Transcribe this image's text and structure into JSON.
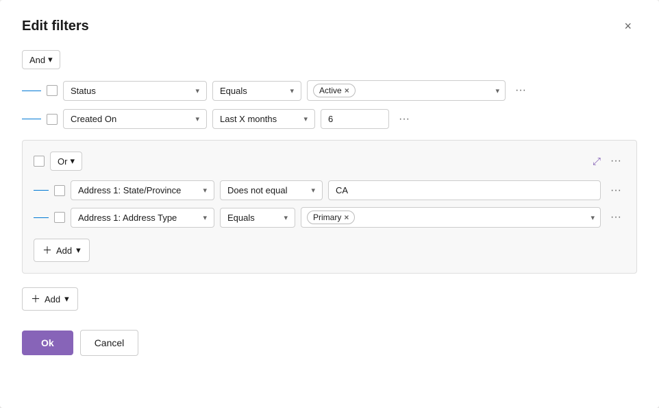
{
  "dialog": {
    "title": "Edit filters",
    "close_label": "×"
  },
  "and_operator": {
    "label": "And",
    "chevron": "▾"
  },
  "row1": {
    "field": "Status",
    "operator": "Equals",
    "value_tag": "Active",
    "chevron": "▾",
    "more": "···"
  },
  "row2": {
    "field": "Created On",
    "operator": "Last X months",
    "value": "6",
    "chevron": "▾",
    "more": "···"
  },
  "or_group": {
    "operator": "Or",
    "chevron": "▾",
    "collapse_icon": "⤢",
    "more": "···",
    "rows": [
      {
        "field": "Address 1: State/Province",
        "operator": "Does not equal",
        "value": "CA",
        "more": "···",
        "chevron": "▾"
      },
      {
        "field": "Address 1: Address Type",
        "operator": "Equals",
        "value_tag": "Primary",
        "chevron": "▾",
        "more": "···"
      }
    ],
    "add_label": "Add",
    "add_chevron": "▾"
  },
  "main_add": {
    "label": "Add",
    "chevron": "▾"
  },
  "footer": {
    "ok_label": "Ok",
    "cancel_label": "Cancel"
  }
}
